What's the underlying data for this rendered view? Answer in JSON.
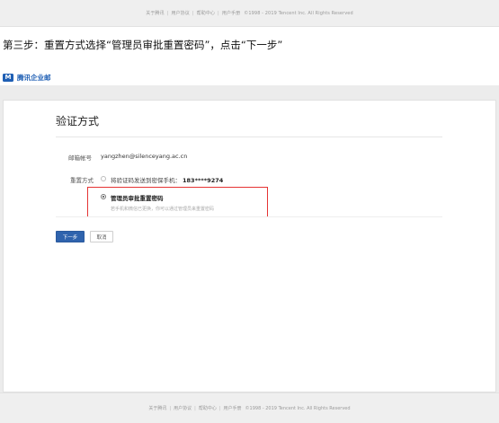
{
  "footer": {
    "links": [
      "关于腾讯",
      "用户协议",
      "帮助中心",
      "用户手册"
    ],
    "copyright": "©1998 - 2019 Tencent Inc. All Rights Reserved"
  },
  "instruction": "第三步：重置方式选择“管理员审批重置密码”，点击“下一步”",
  "brand": {
    "logo_glyph": "M",
    "name": "腾讯企业邮",
    "color": "#1f5fb4"
  },
  "form": {
    "title": "验证方式",
    "email_label": "邮箱帐号",
    "email_value": "yangzhen@silenceyang.ac.cn",
    "method_label": "重置方式",
    "option_sms_text": "将验证码发送到密保手机：",
    "option_sms_phone": "183****9274",
    "option_admin_text": "管理员审批重置密码",
    "option_admin_hint": "若手机和微信已更换，你可以通过管理员来重置密码",
    "selected_option": "admin"
  },
  "buttons": {
    "next": "下一步",
    "cancel": "取消"
  },
  "colors": {
    "primary": "#2f63ad",
    "highlight": "#e53333"
  }
}
